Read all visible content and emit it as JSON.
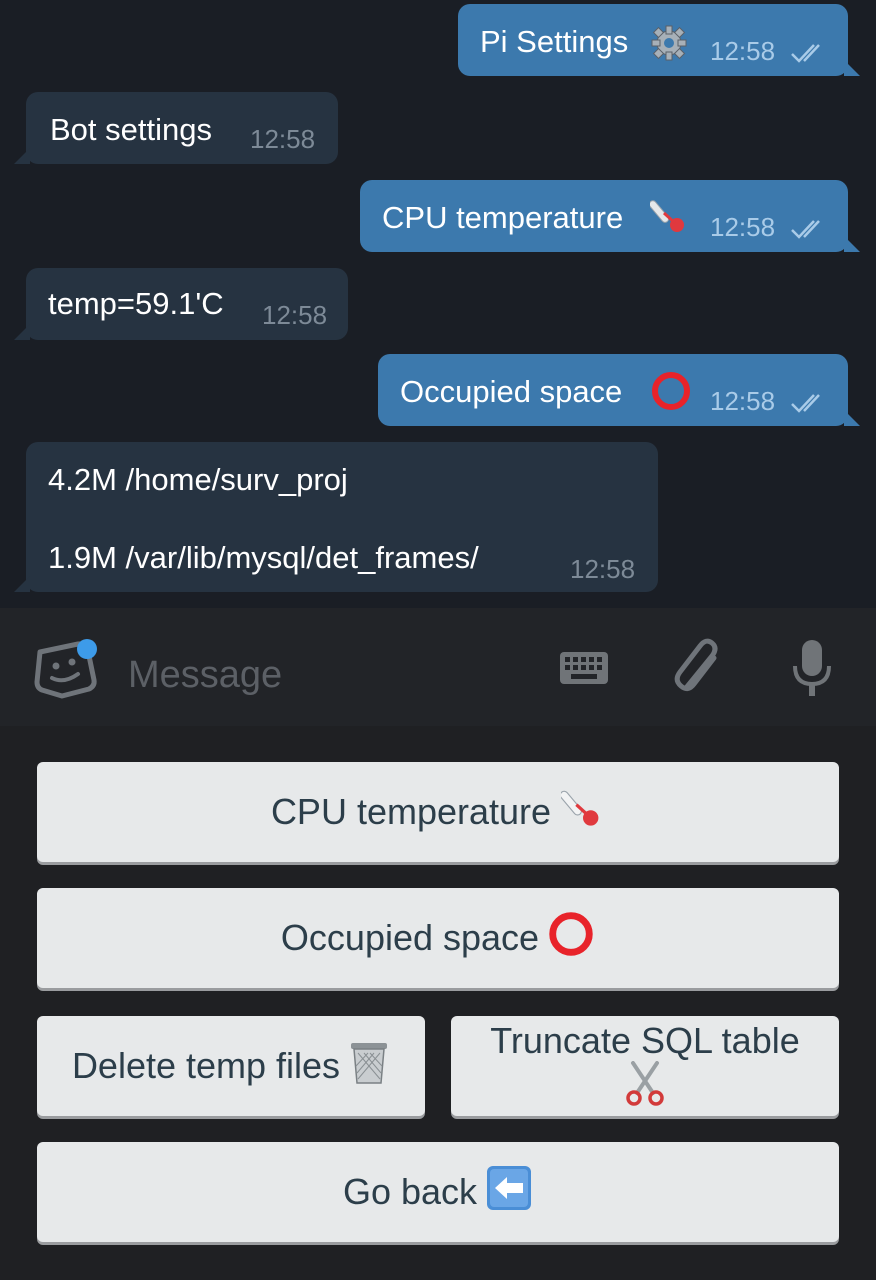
{
  "messages": [
    {
      "text": "Pi Settings",
      "time": "12:58",
      "emoji": "gear-icon"
    },
    {
      "text": "Bot settings",
      "time": "12:58"
    },
    {
      "text": "CPU temperature",
      "time": "12:58",
      "emoji": "thermometer-icon"
    },
    {
      "text": "temp=59.1'C",
      "time": "12:58"
    },
    {
      "text": "Occupied space",
      "time": "12:58",
      "emoji": "red-circle-icon"
    },
    {
      "lines": [
        "4.2M /home/surv_proj",
        "1.9M /var/lib/mysql/det_frames/"
      ],
      "time": "12:58"
    }
  ],
  "input": {
    "placeholder": "Message"
  },
  "keyboard": {
    "cpu_temperature": "CPU temperature",
    "occupied_space": "Occupied space",
    "delete_temp_files": "Delete temp files",
    "truncate_sql_table": "Truncate SQL table",
    "go_back": "Go back"
  },
  "colors": {
    "outgoing_bubble": "#3c79ad",
    "incoming_bubble": "#263341",
    "chat_background": "#1a1e25",
    "keyboard_button": "#e7e9ea",
    "notification_dot": "#3d9be9"
  }
}
